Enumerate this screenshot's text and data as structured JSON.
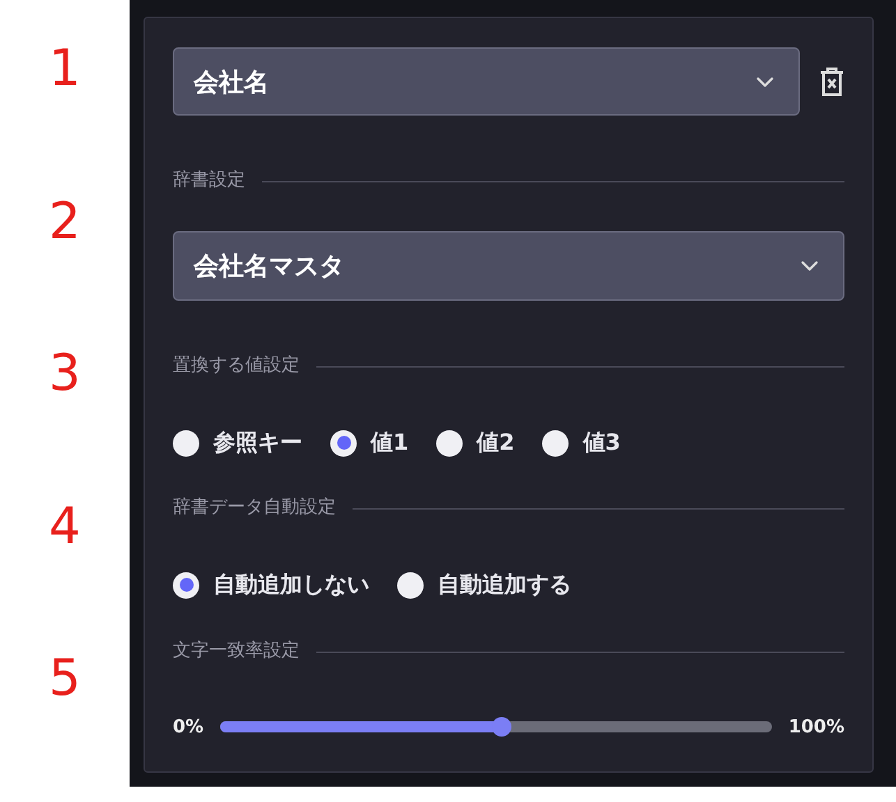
{
  "annotations": [
    "1",
    "2",
    "3",
    "4",
    "5"
  ],
  "field_select": {
    "value": "会社名"
  },
  "dictionary": {
    "label": "辞書設定",
    "select": {
      "value": "会社名マスタ"
    }
  },
  "replace": {
    "label": "置換する値設定",
    "options": [
      {
        "label": "参照キー",
        "selected": false
      },
      {
        "label": "値1",
        "selected": true
      },
      {
        "label": "値2",
        "selected": false
      },
      {
        "label": "値3",
        "selected": false
      }
    ]
  },
  "auto": {
    "label": "辞書データ自動設定",
    "options": [
      {
        "label": "自動追加しない",
        "selected": true
      },
      {
        "label": "自動追加する",
        "selected": false
      }
    ]
  },
  "match": {
    "label": "文字一致率設定",
    "min_label": "0%",
    "max_label": "100%",
    "level": 0.51
  }
}
